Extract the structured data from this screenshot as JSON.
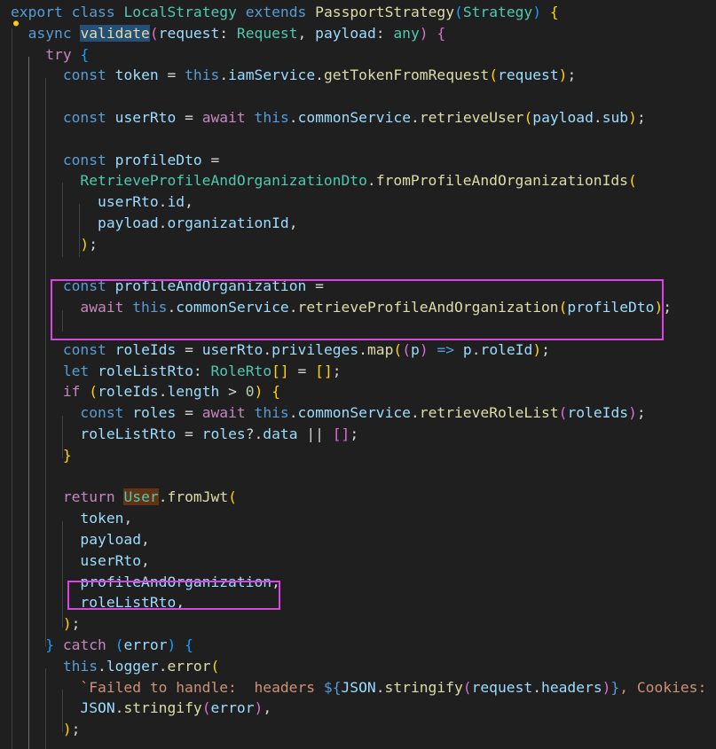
{
  "editor": {
    "language": "typescript",
    "theme": "dark",
    "lightbulb_icon": "lightbulb-icon",
    "lines": [
      [
        [
          "export",
          "kw"
        ],
        [
          " ",
          "p"
        ],
        [
          "class",
          "kw"
        ],
        [
          " ",
          "p"
        ],
        [
          "LocalStrategy",
          "cls"
        ],
        [
          " ",
          "p"
        ],
        [
          "extends",
          "kw"
        ],
        [
          " ",
          "p"
        ],
        [
          "PassportStrategy",
          "fn"
        ],
        [
          "(",
          "b3"
        ],
        [
          "Strategy",
          "cls"
        ],
        [
          ")",
          "b3"
        ],
        [
          " ",
          "p"
        ],
        [
          "{",
          "b1"
        ]
      ],
      [
        [
          "  ",
          "p"
        ],
        [
          "async",
          "kw"
        ],
        [
          " ",
          "p"
        ],
        [
          "validate",
          "fn",
          "word"
        ],
        [
          "(",
          "b2"
        ],
        [
          "request",
          "var"
        ],
        [
          ": ",
          "p"
        ],
        [
          "Request",
          "cls"
        ],
        [
          ", ",
          "p"
        ],
        [
          "payload",
          "var"
        ],
        [
          ": ",
          "p"
        ],
        [
          "any",
          "cls"
        ],
        [
          ")",
          "b2"
        ],
        [
          " ",
          "p"
        ],
        [
          "{",
          "b2"
        ]
      ],
      [
        [
          "    ",
          "p"
        ],
        [
          "try",
          "ctl"
        ],
        [
          " ",
          "p"
        ],
        [
          "{",
          "b3"
        ]
      ],
      [
        [
          "      ",
          "p"
        ],
        [
          "const",
          "kw"
        ],
        [
          " ",
          "p"
        ],
        [
          "token",
          "var"
        ],
        [
          " = ",
          "p"
        ],
        [
          "this",
          "kw"
        ],
        [
          ".",
          "p"
        ],
        [
          "iamService",
          "var"
        ],
        [
          ".",
          "p"
        ],
        [
          "getTokenFromRequest",
          "fn"
        ],
        [
          "(",
          "b1"
        ],
        [
          "request",
          "var"
        ],
        [
          ")",
          "b1"
        ],
        [
          ";",
          "p"
        ]
      ],
      [],
      [
        [
          "      ",
          "p"
        ],
        [
          "const",
          "kw"
        ],
        [
          " ",
          "p"
        ],
        [
          "userRto",
          "var"
        ],
        [
          " = ",
          "p"
        ],
        [
          "await",
          "ctl"
        ],
        [
          " ",
          "p"
        ],
        [
          "this",
          "kw"
        ],
        [
          ".",
          "p"
        ],
        [
          "commonService",
          "var"
        ],
        [
          ".",
          "p"
        ],
        [
          "retrieveUser",
          "fn"
        ],
        [
          "(",
          "b1"
        ],
        [
          "payload",
          "var"
        ],
        [
          ".",
          "p"
        ],
        [
          "sub",
          "var"
        ],
        [
          ")",
          "b1"
        ],
        [
          ";",
          "p"
        ]
      ],
      [],
      [
        [
          "      ",
          "p"
        ],
        [
          "const",
          "kw"
        ],
        [
          " ",
          "p"
        ],
        [
          "profileDto",
          "var"
        ],
        [
          " =",
          "p"
        ]
      ],
      [
        [
          "        ",
          "p"
        ],
        [
          "RetrieveProfileAndOrganizationDto",
          "cls"
        ],
        [
          ".",
          "p"
        ],
        [
          "fromProfileAndOrganizationIds",
          "fn"
        ],
        [
          "(",
          "b1"
        ]
      ],
      [
        [
          "          ",
          "p"
        ],
        [
          "userRto",
          "var"
        ],
        [
          ".",
          "p"
        ],
        [
          "id",
          "var"
        ],
        [
          ",",
          "p"
        ]
      ],
      [
        [
          "          ",
          "p"
        ],
        [
          "payload",
          "var"
        ],
        [
          ".",
          "p"
        ],
        [
          "organizationId",
          "var"
        ],
        [
          ",",
          "p"
        ]
      ],
      [
        [
          "        ",
          "p"
        ],
        [
          ")",
          "b1"
        ],
        [
          ";",
          "p"
        ]
      ],
      [],
      [
        [
          "      ",
          "p"
        ],
        [
          "const",
          "kw"
        ],
        [
          " ",
          "p"
        ],
        [
          "profileAndOrganization",
          "var"
        ],
        [
          " =",
          "p"
        ]
      ],
      [
        [
          "        ",
          "p"
        ],
        [
          "await",
          "ctl"
        ],
        [
          " ",
          "p"
        ],
        [
          "this",
          "kw"
        ],
        [
          ".",
          "p"
        ],
        [
          "commonService",
          "var"
        ],
        [
          ".",
          "p"
        ],
        [
          "retrieveProfileAndOrganization",
          "fn"
        ],
        [
          "(",
          "b1"
        ],
        [
          "profileDto",
          "var"
        ],
        [
          ")",
          "b1"
        ],
        [
          ";",
          "p"
        ]
      ],
      [],
      [
        [
          "      ",
          "p"
        ],
        [
          "const",
          "kw"
        ],
        [
          " ",
          "p"
        ],
        [
          "roleIds",
          "var"
        ],
        [
          " = ",
          "p"
        ],
        [
          "userRto",
          "var"
        ],
        [
          ".",
          "p"
        ],
        [
          "privileges",
          "var"
        ],
        [
          ".",
          "p"
        ],
        [
          "map",
          "fn"
        ],
        [
          "(",
          "b1"
        ],
        [
          "(",
          "b2"
        ],
        [
          "p",
          "var"
        ],
        [
          ")",
          "b2"
        ],
        [
          " ",
          "p"
        ],
        [
          "=>",
          "kw"
        ],
        [
          " ",
          "p"
        ],
        [
          "p",
          "var"
        ],
        [
          ".",
          "p"
        ],
        [
          "roleId",
          "var"
        ],
        [
          ")",
          "b1"
        ],
        [
          ";",
          "p"
        ]
      ],
      [
        [
          "      ",
          "p"
        ],
        [
          "let",
          "kw"
        ],
        [
          " ",
          "p"
        ],
        [
          "roleListRto",
          "var"
        ],
        [
          ": ",
          "p"
        ],
        [
          "RoleRto",
          "cls"
        ],
        [
          "[]",
          "b1"
        ],
        [
          " = ",
          "p"
        ],
        [
          "[]",
          "b1"
        ],
        [
          ";",
          "p"
        ]
      ],
      [
        [
          "      ",
          "p"
        ],
        [
          "if",
          "ctl"
        ],
        [
          " ",
          "p"
        ],
        [
          "(",
          "b1"
        ],
        [
          "roleIds",
          "var"
        ],
        [
          ".",
          "p"
        ],
        [
          "length",
          "var"
        ],
        [
          " > ",
          "p"
        ],
        [
          "0",
          "num"
        ],
        [
          ")",
          "b1"
        ],
        [
          " ",
          "p"
        ],
        [
          "{",
          "b1"
        ]
      ],
      [
        [
          "        ",
          "p"
        ],
        [
          "const",
          "kw"
        ],
        [
          " ",
          "p"
        ],
        [
          "roles",
          "var"
        ],
        [
          " = ",
          "p"
        ],
        [
          "await",
          "ctl"
        ],
        [
          " ",
          "p"
        ],
        [
          "this",
          "kw"
        ],
        [
          ".",
          "p"
        ],
        [
          "commonService",
          "var"
        ],
        [
          ".",
          "p"
        ],
        [
          "retrieveRoleList",
          "fn"
        ],
        [
          "(",
          "b2"
        ],
        [
          "roleIds",
          "var"
        ],
        [
          ")",
          "b2"
        ],
        [
          ";",
          "p"
        ]
      ],
      [
        [
          "        ",
          "p"
        ],
        [
          "roleListRto",
          "var"
        ],
        [
          " = ",
          "p"
        ],
        [
          "roles",
          "var"
        ],
        [
          "?.",
          "p"
        ],
        [
          "data",
          "var"
        ],
        [
          " || ",
          "p"
        ],
        [
          "[]",
          "b2"
        ],
        [
          ";",
          "p"
        ]
      ],
      [
        [
          "      ",
          "p"
        ],
        [
          "}",
          "b1"
        ]
      ],
      [],
      [
        [
          "      ",
          "p"
        ],
        [
          "return",
          "ctl"
        ],
        [
          " ",
          "p"
        ],
        [
          "User",
          "cls",
          "user"
        ],
        [
          ".",
          "p"
        ],
        [
          "fromJwt",
          "fn"
        ],
        [
          "(",
          "b1"
        ]
      ],
      [
        [
          "        ",
          "p"
        ],
        [
          "token",
          "var"
        ],
        [
          ",",
          "p"
        ]
      ],
      [
        [
          "        ",
          "p"
        ],
        [
          "payload",
          "var"
        ],
        [
          ",",
          "p"
        ]
      ],
      [
        [
          "        ",
          "p"
        ],
        [
          "userRto",
          "var"
        ],
        [
          ",",
          "p"
        ]
      ],
      [
        [
          "        ",
          "p"
        ],
        [
          "profileAndOrganization",
          "var"
        ],
        [
          ",",
          "p"
        ]
      ],
      [
        [
          "        ",
          "p"
        ],
        [
          "roleListRto",
          "var"
        ],
        [
          ",",
          "p"
        ]
      ],
      [
        [
          "      ",
          "p"
        ],
        [
          ")",
          "b1"
        ],
        [
          ";",
          "p"
        ]
      ],
      [
        [
          "    ",
          "p"
        ],
        [
          "}",
          "b3"
        ],
        [
          " ",
          "p"
        ],
        [
          "catch",
          "ctl"
        ],
        [
          " ",
          "p"
        ],
        [
          "(",
          "b3"
        ],
        [
          "error",
          "var"
        ],
        [
          ")",
          "b3"
        ],
        [
          " ",
          "p"
        ],
        [
          "{",
          "b3"
        ]
      ],
      [
        [
          "      ",
          "p"
        ],
        [
          "this",
          "kw"
        ],
        [
          ".",
          "p"
        ],
        [
          "logger",
          "var"
        ],
        [
          ".",
          "p"
        ],
        [
          "error",
          "fn"
        ],
        [
          "(",
          "b1"
        ]
      ],
      [
        [
          "        ",
          "p"
        ],
        [
          "`Failed to handle:  headers ",
          "str"
        ],
        [
          "${",
          "kw"
        ],
        [
          "JSON",
          "var"
        ],
        [
          ".",
          "p"
        ],
        [
          "stringify",
          "fn"
        ],
        [
          "(",
          "b2"
        ],
        [
          "request",
          "var"
        ],
        [
          ".",
          "p"
        ],
        [
          "headers",
          "var"
        ],
        [
          ")",
          "b2"
        ],
        [
          "}",
          "kw"
        ],
        [
          ", Cookies: ",
          "str"
        ],
        [
          "${",
          "kw"
        ]
      ],
      [
        [
          "        ",
          "p"
        ],
        [
          "JSON",
          "var"
        ],
        [
          ".",
          "p"
        ],
        [
          "stringify",
          "fn"
        ],
        [
          "(",
          "b2"
        ],
        [
          "error",
          "var"
        ],
        [
          ")",
          "b2"
        ],
        [
          ",",
          "p"
        ]
      ],
      [
        [
          "      ",
          "p"
        ],
        [
          ")",
          "b1"
        ],
        [
          ";",
          "p"
        ]
      ]
    ]
  },
  "colors": {
    "background": "#1f1f1f",
    "highlight_box": "#e040e8"
  }
}
